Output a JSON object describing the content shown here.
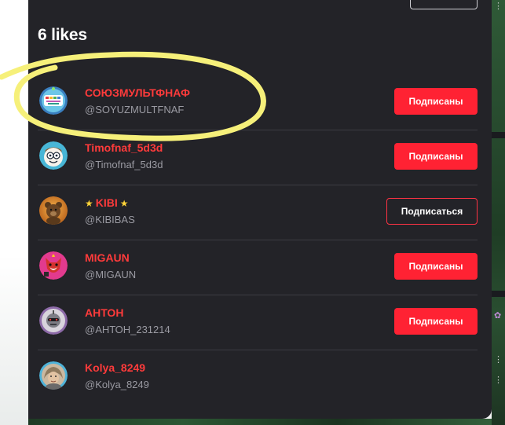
{
  "modal": {
    "title": "6 likes"
  },
  "users": [
    {
      "name": "СОЮЗМУЛЬТФНАФ",
      "handle": "@SOYUZMULTFNAF",
      "button": "Подписаны",
      "subscribed": true,
      "avatar_icon": "soyuzmult-logo-icon"
    },
    {
      "name": "Timofnaf_5d3d",
      "handle": "@Timofnaf_5d3d",
      "button": "Подписаны",
      "subscribed": true,
      "avatar_icon": "cartoon-face-icon"
    },
    {
      "name": "KIBI",
      "name_prefix": "★",
      "name_suffix": "★",
      "handle": "@KIBIBAS",
      "button": "Подписаться",
      "subscribed": false,
      "avatar_icon": "teddy-bear-icon"
    },
    {
      "name": "MIGAUN",
      "handle": "@MIGAUN",
      "button": "Подписаны",
      "subscribed": true,
      "avatar_icon": "red-fox-icon"
    },
    {
      "name": "АНТОН",
      "handle": "@АНТОН_231214",
      "button": "Подписаны",
      "subscribed": true,
      "avatar_icon": "robot-head-icon"
    },
    {
      "name": "Kolya_8249",
      "handle": "@Kolya_8249",
      "button": "",
      "subscribed": null,
      "avatar_icon": "person-photo-icon"
    }
  ],
  "colors": {
    "modal_bg": "#232328",
    "accent_red": "#ff2233",
    "name_red": "#ff3b3b",
    "highlight_yellow": "#f6f07a"
  },
  "background_glyphs": [
    "⋮",
    "✿",
    "⋮",
    "⋮"
  ]
}
